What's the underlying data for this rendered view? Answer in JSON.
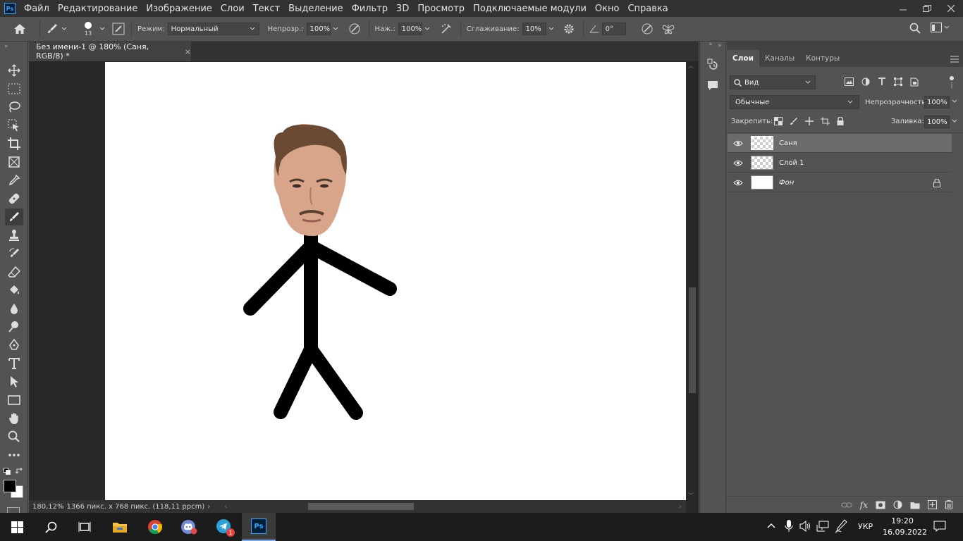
{
  "menu": {
    "items": [
      "Файл",
      "Редактирование",
      "Изображение",
      "Слои",
      "Текст",
      "Выделение",
      "Фильтр",
      "3D",
      "Просмотр",
      "Подключаемые модули",
      "Окно",
      "Справка"
    ],
    "logo": "Ps"
  },
  "options": {
    "brush_size": "13",
    "mode_label": "Режим:",
    "mode_value": "Нормальный",
    "opacity_label": "Непрозр.:",
    "opacity_value": "100%",
    "flow_label": "Наж.:",
    "flow_value": "100%",
    "smoothing_label": "Сглаживание:",
    "smoothing_value": "10%",
    "angle_value": "0°"
  },
  "document": {
    "tab_title": "Без имени-1 @ 180% (Саня, RGB/8) *",
    "status_zoom": "180,12%",
    "status_info": "1366 пикс. x 768 пикс. (118,11 ppcm)"
  },
  "layers_panel": {
    "tabs": [
      "Слои",
      "Каналы",
      "Контуры"
    ],
    "filter_label": "Вид",
    "blend_mode": "Обычные",
    "opacity_label": "Непрозрачность:",
    "opacity_value": "100%",
    "lock_label": "Закрепить:",
    "fill_label": "Заливка:",
    "fill_value": "100%",
    "layers": [
      {
        "name": "Саня",
        "selected": true,
        "locked": false
      },
      {
        "name": "Слой 1",
        "selected": false,
        "locked": false
      },
      {
        "name": "Фон",
        "selected": false,
        "locked": true
      }
    ]
  },
  "taskbar": {
    "language": "УКР",
    "time": "19:20",
    "date": "16.09.2022",
    "telegram_badge": "1"
  },
  "colors": {
    "accent": "#31a8ff",
    "panel": "#535353",
    "dark": "#323232"
  }
}
